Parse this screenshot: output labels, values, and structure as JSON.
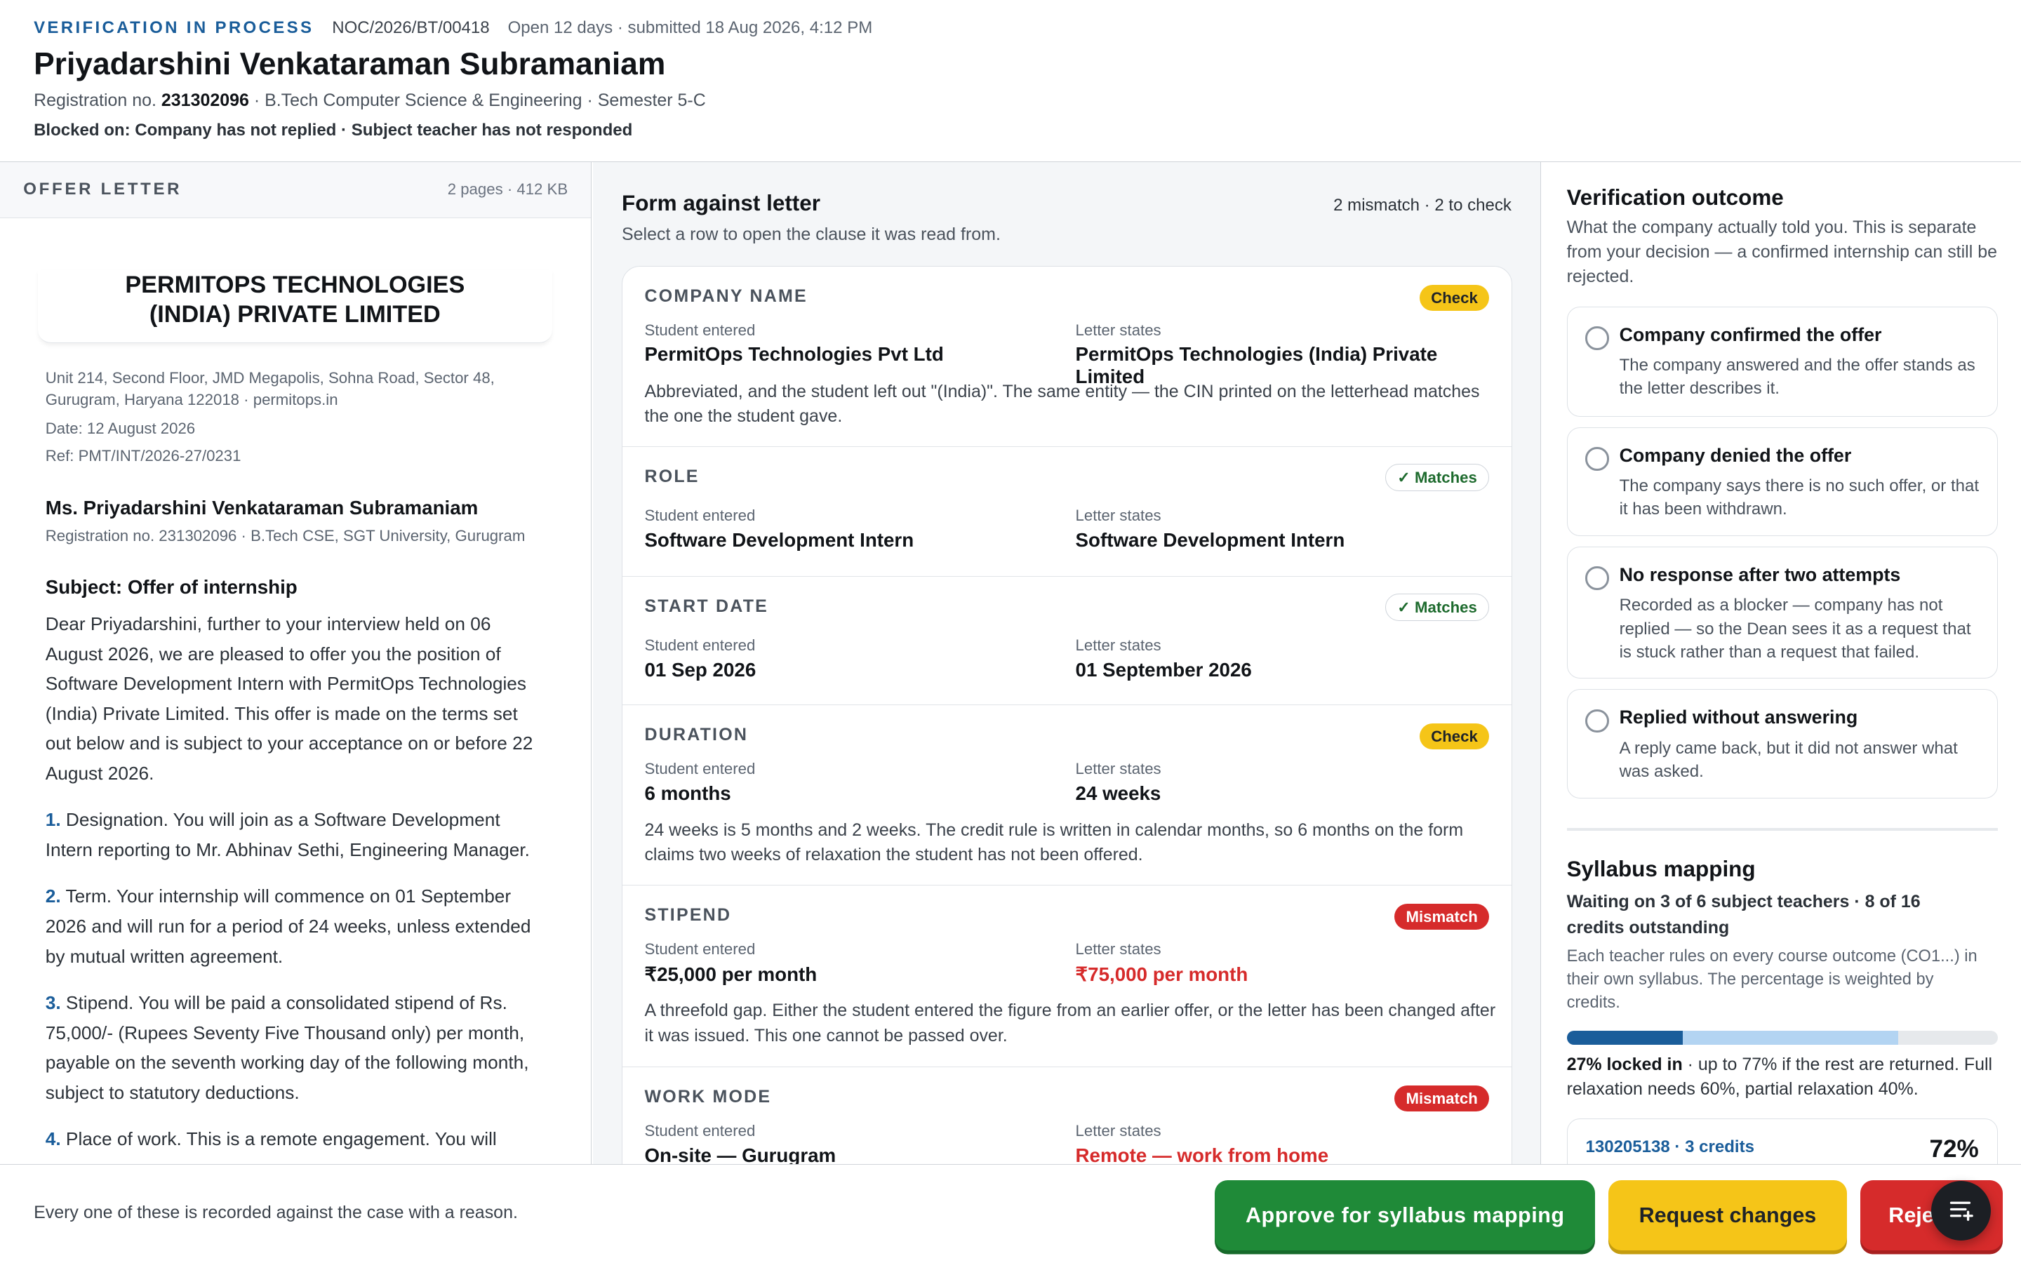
{
  "header": {
    "status": "VERIFICATION IN PROCESS",
    "case_id": "NOC/2026/BT/00418",
    "open_info": "Open 12 days · submitted 18 Aug 2026, 4:12 PM",
    "student_name": "Priyadarshini Venkataraman Subramaniam",
    "reg_prefix": "Registration no. ",
    "reg_no": "231302096",
    "reg_suffix": " · B.Tech Computer Science & Engineering · Semester 5-C",
    "blocked": "Blocked on: Company has not replied · Subject teacher has not responded"
  },
  "letter": {
    "bar_title": "OFFER LETTER",
    "bar_meta": "2 pages · 412 KB",
    "company_line1": "PERMITOPS TECHNOLOGIES",
    "company_line2": "(INDIA) PRIVATE LIMITED",
    "address": "Unit 214, Second Floor, JMD Megapolis, Sohna Road, Sector 48, Gurugram, Haryana 122018 · permitops.in",
    "date": "Date: 12 August 2026",
    "ref": "Ref: PMT/INT/2026-27/0231",
    "to": "Ms. Priyadarshini Venkataraman Subramaniam",
    "to_reg": "Registration no. 231302096 · B.Tech CSE, SGT University, Gurugram",
    "subject": "Subject: Offer of internship",
    "body": "Dear Priyadarshini, further to your interview held on 06 August 2026, we are pleased to offer you the position of Software Development Intern with PermitOps Technologies (India) Private Limited. This offer is made on the terms set out below and is subject to your acceptance on or before 22 August 2026.",
    "clauses": [
      {
        "num": "1.",
        "text": " Designation. You will join as a Software Development Intern reporting to Mr. Abhinav Sethi, Engineering Manager."
      },
      {
        "num": "2.",
        "text": " Term. Your internship will commence on 01 September 2026 and will run for a period of 24 weeks, unless extended by mutual written agreement."
      },
      {
        "num": "3.",
        "text": " Stipend. You will be paid a consolidated stipend of Rs. 75,000/- (Rupees Seventy Five Thousand only) per month, payable on the seventh working day of the following month, subject to statutory deductions."
      },
      {
        "num": "4.",
        "text": " Place of work. This is a remote engagement. You will"
      }
    ]
  },
  "form": {
    "title": "Form against letter",
    "subtitle": "Select a row to open the clause it was read from.",
    "counts": "2 mismatch · 2 to check",
    "student_label": "Student entered",
    "letter_label": "Letter states",
    "rows": [
      {
        "label": "COMPANY NAME",
        "badge": "Check",
        "student": "PermitOps Technologies Pvt Ltd",
        "letter": "PermitOps Technologies (India) Private Limited",
        "note": "Abbreviated, and the student left out \"(India)\". The same entity — the CIN printed on the letterhead matches the one the student gave."
      },
      {
        "label": "ROLE",
        "badge": "✓ Matches",
        "student": "Software Development Intern",
        "letter": "Software Development Intern"
      },
      {
        "label": "START DATE",
        "badge": "✓ Matches",
        "student": "01 Sep 2026",
        "letter": "01 September 2026"
      },
      {
        "label": "DURATION",
        "badge": "Check",
        "student": "6 months",
        "letter": "24 weeks",
        "note": "24 weeks is 5 months and 2 weeks. The credit rule is written in calendar months, so 6 months on the form claims two weeks of relaxation the student has not been offered."
      },
      {
        "label": "STIPEND",
        "badge": "Mismatch",
        "student": "₹25,000 per month",
        "letter": "₹75,000 per month",
        "note": "A threefold gap. Either the student entered the figure from an earlier offer, or the letter has been changed after it was issued. This one cannot be passed over."
      },
      {
        "label": "WORK MODE",
        "badge": "Mismatch",
        "student": "On-site — Gurugram",
        "letter": "Remote — work from home"
      }
    ]
  },
  "outcome": {
    "title": "Verification outcome",
    "subtitle": "What the company actually told you. This is separate from your decision — a confirmed internship can still be rejected.",
    "options": [
      {
        "title": "Company confirmed the offer",
        "desc": "The company answered and the offer stands as the letter describes it."
      },
      {
        "title": "Company denied the offer",
        "desc": "The company says there is no such offer, or that it has been withdrawn."
      },
      {
        "title": "No response after two attempts",
        "desc": "Recorded as a blocker — company has not replied — so the Dean sees it as a request that is stuck rather than a request that failed."
      },
      {
        "title": "Replied without answering",
        "desc": "A reply came back, but it did not answer what was asked."
      }
    ]
  },
  "syllabus": {
    "title": "Syllabus mapping",
    "waiting": "Waiting on 3 of 6 subject teachers · 8 of 16 credits outstanding",
    "desc": "Each teacher rules on every course outcome (CO1...) in their own syllabus. The percentage is weighted by credits.",
    "locked_pct": 27,
    "potential_pct": 77,
    "locked_text": "27% locked in",
    "locked_rest": " · up to 77% if the rest are returned. Full relaxation needs 60%, partial relaxation 40%.",
    "subject_code": "130205138 · 3 credits",
    "subject_pct": "72%"
  },
  "footer": {
    "note": "Every one of these is recorded against the case with a reason.",
    "approve": "Approve for syllabus mapping",
    "changes": "Request changes",
    "reject": "Reject"
  },
  "colors": {
    "accent": "#1a5d9a",
    "approve": "#1f8a38",
    "check": "#f5c518",
    "mismatch": "#d62b2b"
  }
}
